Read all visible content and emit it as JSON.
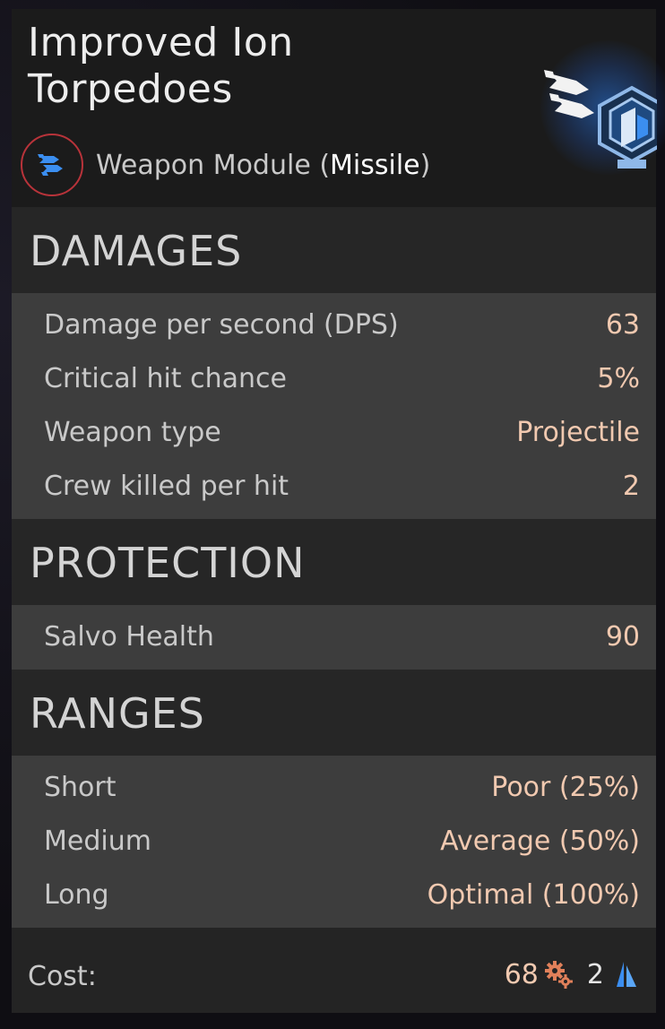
{
  "header": {
    "title": "Improved Ion Torpedoes",
    "type_prefix": "Weapon Module (",
    "type_strong": "Missile",
    "type_suffix": ")",
    "type_icon": "missile-icon",
    "module_icon": "blue-module-cube-icon"
  },
  "sections": {
    "damages": {
      "title": "DAMAGES",
      "rows": [
        {
          "label": "Damage per second (DPS)",
          "value": "63"
        },
        {
          "label": "Critical hit chance",
          "value": "5%"
        },
        {
          "label": "Weapon type",
          "value": "Projectile"
        },
        {
          "label": "Crew killed per hit",
          "value": "2"
        }
      ]
    },
    "protection": {
      "title": "PROTECTION",
      "rows": [
        {
          "label": "Salvo Health",
          "value": "90"
        }
      ]
    },
    "ranges": {
      "title": "RANGES",
      "rows": [
        {
          "label": "Short",
          "value": "Poor (25%)"
        },
        {
          "label": "Medium",
          "value": "Average (50%)"
        },
        {
          "label": "Long",
          "value": "Optimal (100%)"
        }
      ]
    }
  },
  "cost": {
    "label": "Cost:",
    "parts": "68",
    "parts_icon": "gears-icon",
    "crystals": "2",
    "crystals_icon": "blue-crystal-icon"
  },
  "colors": {
    "value_text": "#f1c9b0",
    "badge_ring": "#b8333a",
    "accent_blue": "#3b8ef0"
  }
}
